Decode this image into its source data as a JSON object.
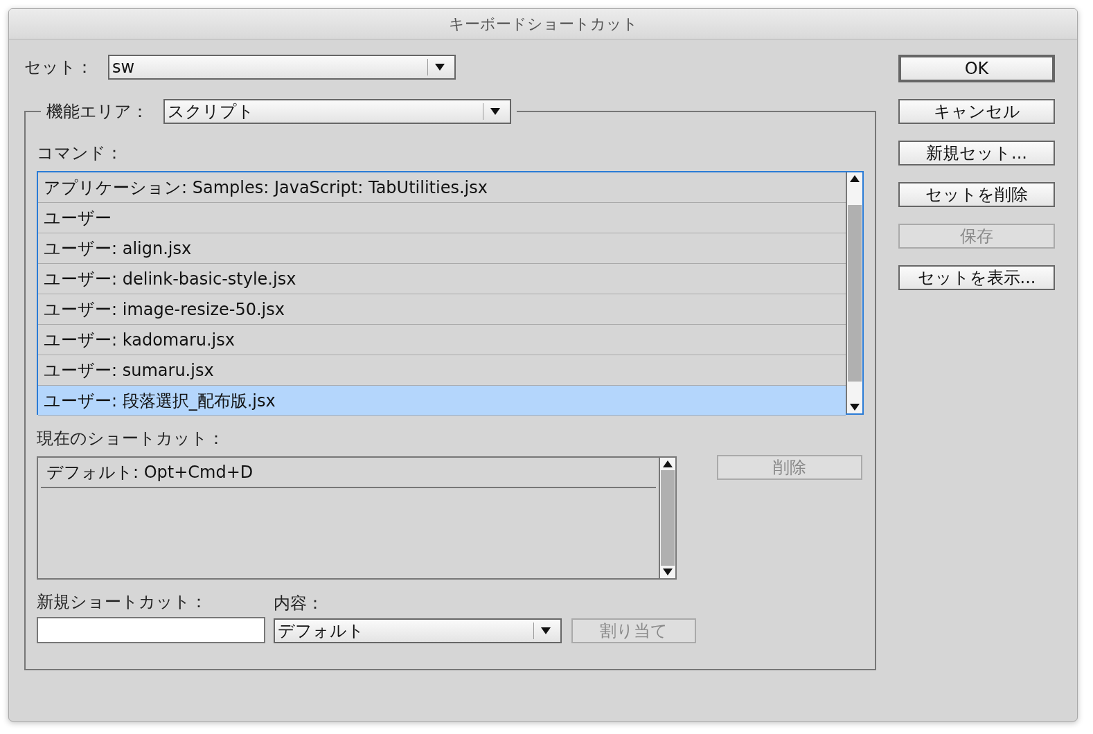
{
  "window": {
    "title": "キーボードショートカット"
  },
  "set": {
    "label": "セット：",
    "value": "sw"
  },
  "area": {
    "label": "機能エリア：",
    "value": "スクリプト"
  },
  "commands": {
    "label": "コマンド：",
    "items": [
      {
        "text": "アプリケーション: Samples: JavaScript: TabUtilities.jsx",
        "selected": false
      },
      {
        "text": "ユーザー",
        "selected": false
      },
      {
        "text": "ユーザー: align.jsx",
        "selected": false
      },
      {
        "text": "ユーザー: delink-basic-style.jsx",
        "selected": false
      },
      {
        "text": "ユーザー: image-resize-50.jsx",
        "selected": false
      },
      {
        "text": "ユーザー: kadomaru.jsx",
        "selected": false
      },
      {
        "text": "ユーザー: sumaru.jsx",
        "selected": false
      },
      {
        "text": "ユーザー: 段落選択_配布版.jsx",
        "selected": true
      }
    ]
  },
  "current": {
    "label": "現在のショートカット：",
    "items": [
      "デフォルト: Opt+Cmd+D"
    ],
    "delete_button": {
      "label": "削除",
      "disabled": true
    }
  },
  "new_shortcut": {
    "label": "新規ショートカット："
  },
  "context": {
    "label": "内容：",
    "value": "デフォルト"
  },
  "assign_button": {
    "label": "割り当て",
    "disabled": true
  },
  "buttons": [
    {
      "label": "OK",
      "default": true,
      "disabled": false
    },
    {
      "label": "キャンセル",
      "default": false,
      "disabled": false
    },
    {
      "label": "新規セット...",
      "default": false,
      "disabled": false
    },
    {
      "label": "セットを削除",
      "default": false,
      "disabled": false
    },
    {
      "label": "保存",
      "default": false,
      "disabled": true
    },
    {
      "label": "セットを表示...",
      "default": false,
      "disabled": false
    }
  ]
}
